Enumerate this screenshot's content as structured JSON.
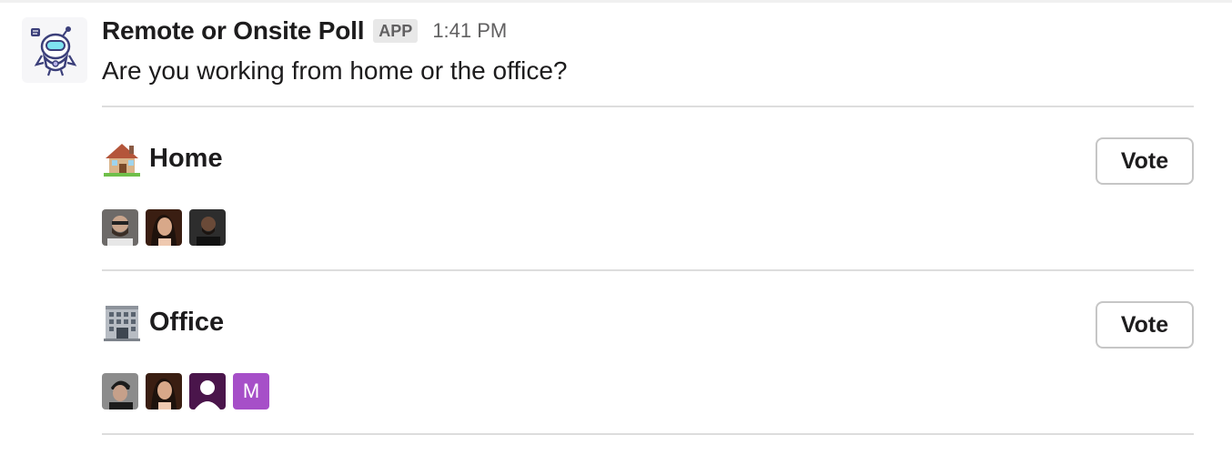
{
  "message": {
    "app_name": "Remote or Onsite Poll",
    "badge": "APP",
    "timestamp": "1:41 PM",
    "question": "Are you working from home or the office?"
  },
  "options": [
    {
      "icon": "house-icon",
      "label": "Home",
      "vote_label": "Vote",
      "voters": [
        "avatar-1",
        "avatar-2",
        "avatar-3"
      ]
    },
    {
      "icon": "office-building-icon",
      "label": "Office",
      "vote_label": "Vote",
      "voters": [
        "avatar-4",
        "avatar-2",
        "avatar-placeholder",
        "M"
      ]
    }
  ],
  "colors": {
    "divider": "#dddddd",
    "badge_bg": "#e8e8e8",
    "letter_avatar": "#a64fc8"
  }
}
